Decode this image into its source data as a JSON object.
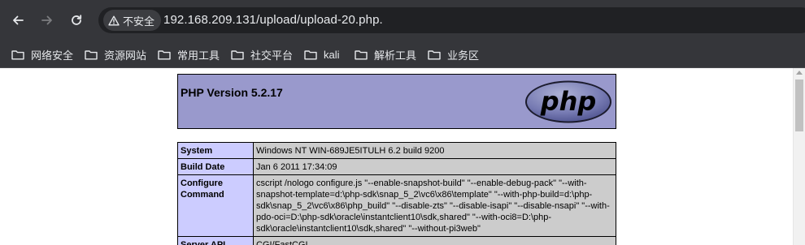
{
  "browser": {
    "security_label": "不安全",
    "url": "192.168.209.131/upload/upload-20.php.",
    "bookmarks": [
      {
        "label": "网络安全"
      },
      {
        "label": "资源网站"
      },
      {
        "label": "常用工具"
      },
      {
        "label": "社交平台"
      },
      {
        "label": "kali"
      },
      {
        "label": "解析工具"
      },
      {
        "label": "业务区"
      }
    ]
  },
  "page": {
    "title": "PHP Version 5.2.17",
    "logo_text": "php",
    "rows": [
      {
        "key": "System",
        "value": "Windows NT WIN-689JE5ITULH 6.2 build 9200"
      },
      {
        "key": "Build Date",
        "value": "Jan 6 2011 17:34:09"
      },
      {
        "key": "Configure Command",
        "value": "cscript /nologo configure.js \"--enable-snapshot-build\" \"--enable-debug-pack\" \"--with-snapshot-template=d:\\php-sdk\\snap_5_2\\vc6\\x86\\template\" \"--with-php-build=d:\\php-sdk\\snap_5_2\\vc6\\x86\\php_build\" \"--disable-zts\" \"--disable-isapi\" \"--disable-nsapi\" \"--with-pdo-oci=D:\\php-sdk\\oracle\\instantclient10\\sdk,shared\" \"--with-oci8=D:\\php-sdk\\oracle\\instantclient10\\sdk,shared\" \"--without-pi3web\""
      },
      {
        "key": "Server API",
        "value": "CGI/FastCGI"
      }
    ]
  }
}
